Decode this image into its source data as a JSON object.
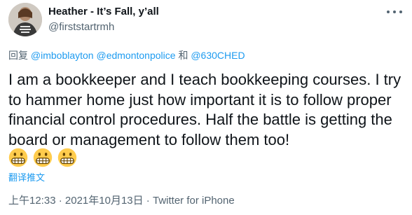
{
  "author": {
    "display_name": "Heather - It’s Fall, y’all",
    "handle": "@firststartrmh"
  },
  "reply_to": {
    "prefix": "回复",
    "user1": "@imboblayton",
    "user2": "@edmontonpolice",
    "conjunction": "和",
    "user3": "@630CHED"
  },
  "tweet": {
    "text": "I am a bookkeeper and I teach bookkeeping courses. I try to hammer home just how important it is to follow proper financial control procedures. Half the battle is getting the board or management to follow them too!",
    "emojis": [
      "grimacing-face",
      "grimacing-face",
      "grimacing-face"
    ],
    "translate_label": "翻译推文"
  },
  "meta": {
    "time": "上午12:33",
    "separator1": " · ",
    "date": "2021年10月13日",
    "separator2": " · ",
    "source": "Twitter for iPhone"
  },
  "colors": {
    "link": "#1d9bf0",
    "secondary": "#536471",
    "primary_text": "#0f1419"
  }
}
